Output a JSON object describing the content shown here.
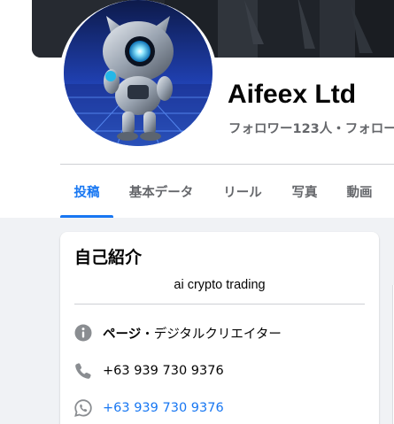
{
  "profile": {
    "name": "Aifeex Ltd",
    "followers_line": "フォロワー123人・フォロー"
  },
  "tabs": [
    {
      "label": "投稿",
      "active": true
    },
    {
      "label": "基本データ",
      "active": false
    },
    {
      "label": "リール",
      "active": false
    },
    {
      "label": "写真",
      "active": false
    },
    {
      "label": "動画",
      "active": false
    }
  ],
  "intro": {
    "title": "自己紹介",
    "bio": "ai crypto trading",
    "category_prefix": "ページ",
    "category_text": "・デジタルクリエイター",
    "phone": "+63 939 730 9376",
    "whatsapp": "+63 939 730 9376"
  },
  "colors": {
    "accent": "#1877f2",
    "text_secondary": "#65676b",
    "background": "#f0f2f5"
  },
  "icons": [
    "info-icon",
    "phone-icon",
    "whatsapp-icon"
  ]
}
